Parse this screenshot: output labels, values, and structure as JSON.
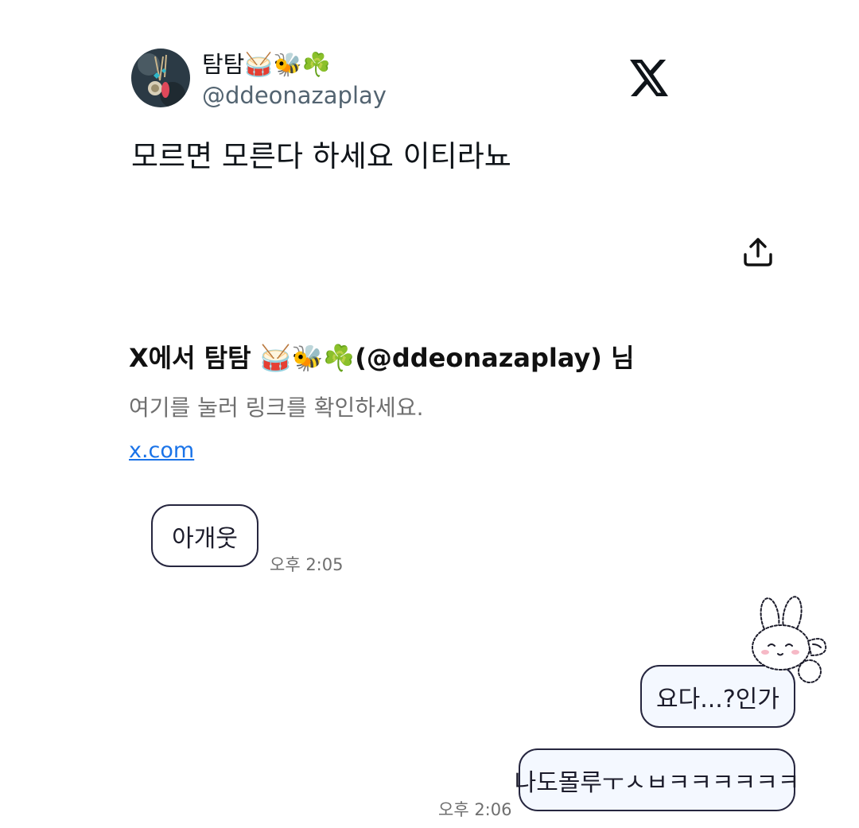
{
  "tweet": {
    "display_name": "탐탐🥁🐝☘️",
    "handle": "@ddeonazaplay",
    "text": "모르면 모른다 하세요 이티라뇨"
  },
  "preview": {
    "title": "X에서 탐탐 🥁🐝☘️(@ddeonazaplay) 님",
    "description": "여기를 눌러 링크를 확인하세요.",
    "link": "x.com"
  },
  "messages": [
    {
      "text": "아개웃",
      "time": "오후 2:05",
      "sender": "other"
    },
    {
      "text": "요다...?인가",
      "time": "",
      "sender": "me"
    },
    {
      "text": "나도몰루ㅜㅅㅂㅋㅋㅋㅋㅋㅋ",
      "time": "오후 2:06",
      "sender": "me"
    }
  ],
  "icons": {
    "brand": "x-logo-icon",
    "share": "share-icon",
    "sticker": "bunny-sticker-icon"
  },
  "colors": {
    "link": "#1a73e8",
    "bubble_border": "#26263f",
    "handle": "#536471"
  }
}
